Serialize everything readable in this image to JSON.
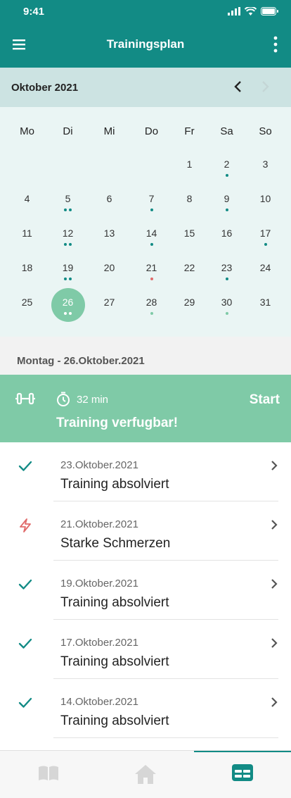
{
  "status_bar": {
    "time": "9:41"
  },
  "app_bar": {
    "title": "Trainingsplan"
  },
  "calendar": {
    "month_label": "Oktober 2021",
    "weekdays": [
      "Mo",
      "Di",
      "Mi",
      "Do",
      "Fr",
      "Sa",
      "So"
    ],
    "first_weekday_index": 4,
    "days_in_month": 31,
    "selected_day": 26,
    "markers": {
      "2": [
        "teal"
      ],
      "5": [
        "teal",
        "teal"
      ],
      "7": [
        "teal"
      ],
      "9": [
        "teal"
      ],
      "12": [
        "teal",
        "teal"
      ],
      "14": [
        "teal"
      ],
      "17": [
        "teal"
      ],
      "19": [
        "teal",
        "teal"
      ],
      "21": [
        "red"
      ],
      "23": [
        "teal"
      ],
      "26": [
        "white",
        "white"
      ],
      "28": [
        "light"
      ],
      "30": [
        "light"
      ]
    }
  },
  "selected_date_label": "Montag - 26.Oktober.2021",
  "training": {
    "duration": "32 min",
    "status": "Training verfugbar!",
    "start_label": "Start"
  },
  "history": [
    {
      "icon": "check-icon",
      "date": "23.Oktober.2021",
      "description": "Training absolviert"
    },
    {
      "icon": "lightning-icon",
      "date": "21.Oktober.2021",
      "description": "Starke Schmerzen"
    },
    {
      "icon": "check-icon",
      "date": "19.Oktober.2021",
      "description": "Training absolviert"
    },
    {
      "icon": "check-icon",
      "date": "17.Oktober.2021",
      "description": "Training absolviert"
    },
    {
      "icon": "check-icon",
      "date": "14.Oktober.2021",
      "description": "Training absolviert"
    }
  ],
  "bottom_nav": {
    "tabs": [
      {
        "icon": "book-icon",
        "active": false
      },
      {
        "icon": "home-icon",
        "active": false
      },
      {
        "icon": "plan-icon",
        "active": true
      }
    ]
  },
  "colors": {
    "primary": "#128b85",
    "accent": "#7fcaa7",
    "pain": "#e06b6b",
    "calendar_bg": "#eaf5f4",
    "month_bar_bg": "#cce3e2"
  }
}
